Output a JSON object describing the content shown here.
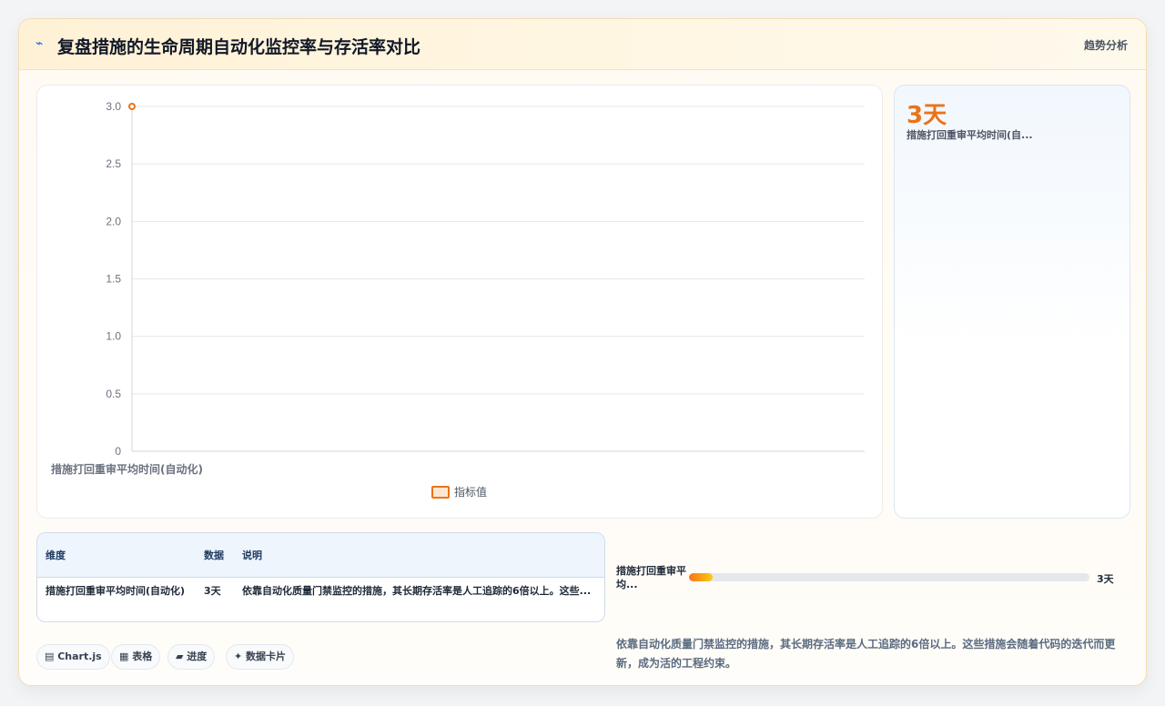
{
  "header": {
    "icon": "trend-icon",
    "title": "复盘措施的生命周期自动化监控率与存活率对比",
    "tag": "趋势分析"
  },
  "chart_data": {
    "type": "line",
    "categories": [
      "措施打回重审平均时间(自动化)"
    ],
    "series": [
      {
        "name": "指标值",
        "values": [
          3
        ]
      }
    ],
    "yticks": [
      "0",
      "0.5",
      "1.0",
      "1.5",
      "2.0",
      "2.5",
      "3.0"
    ],
    "ylim": [
      0,
      3
    ],
    "grid": true,
    "legend": "bottom",
    "color": "#ea7317"
  },
  "kpi": {
    "value": "3天",
    "label": "措施打回重审平均时间(自..."
  },
  "table": {
    "headers": [
      "维度",
      "数据",
      "说明"
    ],
    "rows": [
      [
        "措施打回重审平均时间(自动化)",
        "3天",
        "依靠自动化质量门禁监控的措施，其长期存活率是人工追踪的6倍以上。这些..."
      ]
    ]
  },
  "chips": [
    "▤ Chart.js",
    "▦ 表格",
    "▰ 进度",
    "✦ 数据卡片"
  ],
  "progress": {
    "label": "措施打回重审平均...",
    "value_text": "3天",
    "fraction": 0.06
  },
  "note": "依靠自动化质量门禁监控的措施，其长期存活率是人工追踪的6倍以上。这些措施会随着代码的迭代而更新，成为活的工程约束。",
  "colors": {
    "accent": "#ea7317",
    "grid": "#e5e7eb"
  }
}
